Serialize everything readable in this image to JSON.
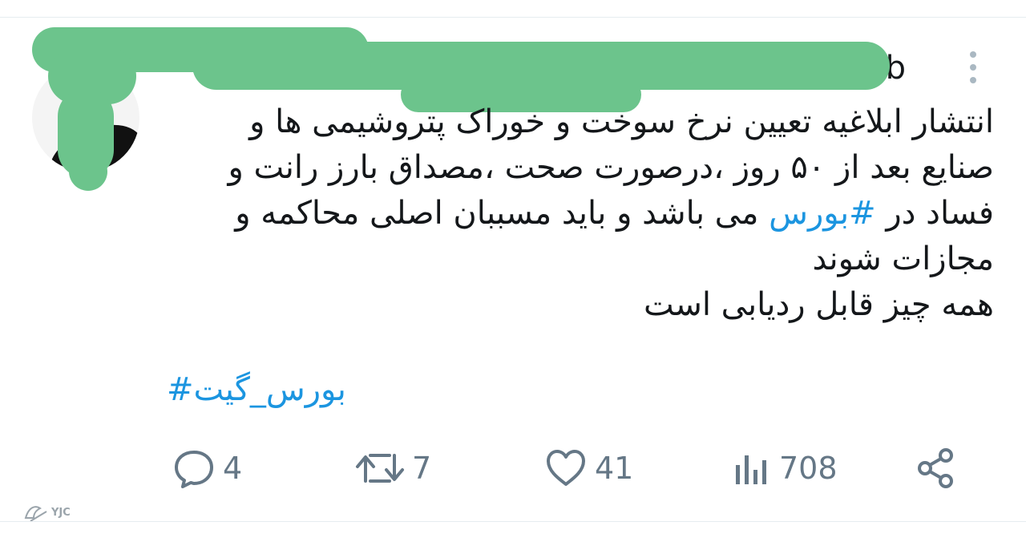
{
  "tweet": {
    "header_visible_fragment": "b",
    "text_lines": [
      "انتشار ابلاغیه  تعیین نرخ سوخت و خوراک پتروشیمی ها و",
      "صنایع بعد از ۵۰ روز ،درصورت صحت ،مصداق بارز رانت و",
      "فساد در ",
      "مجازات شوند",
      "همه چیز قابل ردیابی است"
    ],
    "line3_hashtag": "#بورس",
    "line3_rest": " می باشد و باید مسببان اصلی محاکمه و",
    "footer_hashtag": "بورس_گیت#"
  },
  "actions": {
    "replies": "4",
    "retweets": "7",
    "likes": "41",
    "views": "708"
  },
  "watermark": {
    "label": "YJC"
  },
  "colors": {
    "link": "#1b95e0",
    "icon": "#657786",
    "redaction": "#6cc48c"
  }
}
